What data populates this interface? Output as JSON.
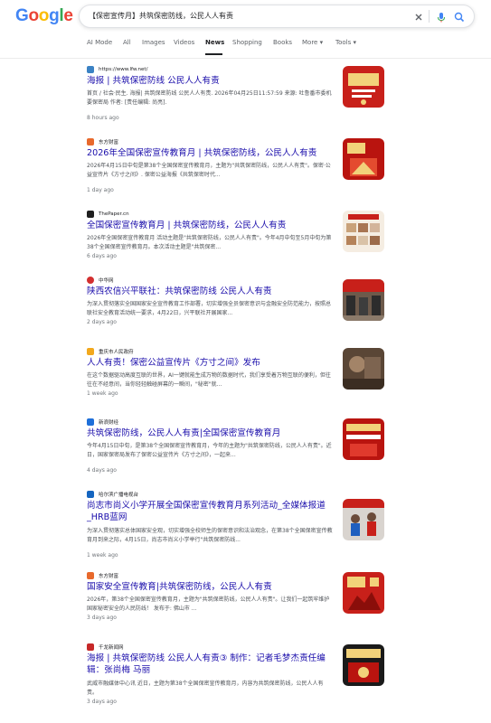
{
  "search": {
    "query": "【保密宣传月】共筑保密防线，公民人人有责",
    "logo": "Google"
  },
  "tabs": [
    {
      "label": "AI Mode"
    },
    {
      "label": "All"
    },
    {
      "label": "Images"
    },
    {
      "label": "Videos"
    },
    {
      "label": "News"
    },
    {
      "label": "Shopping"
    },
    {
      "label": "Books"
    },
    {
      "label": "More ▾"
    },
    {
      "label": "Tools ▾"
    }
  ],
  "results": [
    {
      "source": "https://www.lfw.net/",
      "title": "海报 | 共筑保密防线 公民人人有责",
      "snippet": "首页 / 社会·民生. 海报| 共筑保密防线 公民人人有责. 2026年04月25日11:57:59 来源: 吐鲁番市委机要保密局 作者: [责任编辑: 尚亮].",
      "age": "8 hours ago"
    },
    {
      "source": "东方财富",
      "title": "2026年全国保密宣传教育月 | 共筑保密防线，公民人人有责",
      "snippet": "2026年4月15日中旬是第38个全国保密宣传教育月，主题为\"共筑保密防线，公民人人有责\"。保密·公益宣传片《方寸之间》. 保密公益海报《共筑保密时代...",
      "age": "1 day ago"
    },
    {
      "source": "ThePaper.cn",
      "title": "全国保密宣传教育月 | 共筑保密防线，公民人人有责",
      "snippet": "2026年全国保密宣传教育月 活动主题是\"共筑保密防线，公民人人有责\"。今年4月中旬至5月中旬为第38个全国保密宣传教育月。本次活动主题是\"共筑保密...",
      "age": "6 days ago"
    },
    {
      "source": "中华网",
      "title": "陕西农信兴平联社：共筑保密防线 公民人人有责",
      "snippet": "为深入贯彻落实全国国家安全宣传教育工作部署，切实增强全员保密意识与金融安全防范能力，按照总联社安全教育活动统一要求，4月22日，兴平联社开展国家...",
      "age": "2 days ago"
    },
    {
      "source": "重庆市人民政府",
      "title": "人人有责！保密公益宣传片《方寸之间》发布",
      "snippet": "在这个数据驱动高度互联的世界，AI一键就能生成万物的数据时代，我们享受着万物互联的便利，但往往在不经意间，当你轻轻触碰屏幕的一瞬间，\"秘密\"就...",
      "age": "1 week ago"
    },
    {
      "source": "新浪财经",
      "title": "共筑保密防线，公民人人有责|全国保密宣传教育月",
      "snippet": "今年4月15日中旬，是第38个全国保密宣传教育月，今年的主题为\"共筑保密防线，公民人人有责\"。近日，国家保密局发布了保密公益宣传片《方寸之间》，一起来...",
      "age": "4 days ago"
    },
    {
      "source": "哈尔滨广播电视台",
      "title": "尚志市尚义小学开展全国保密宣传教育月系列活动_全媒体报道_HRB蓝网",
      "snippet": "为深入贯彻落实总体国家安全观，切实增强全校师生的保密意识和法治观念，在第38个全国保密宣传教育月到来之际，4月15日，尚志市尚义小学举行\"共筑保密防线...",
      "age": "1 week ago"
    },
    {
      "source": "东方财富",
      "title": "国家安全宣传教育|共筑保密防线，公民人人有责",
      "snippet": "2026年，第38个全国保密宣传教育月，主题为\"共筑保密防线，公民人人有责\"。让我们一起筑牢维护国家秘密安全的人民防线！ 发布于: 佛山市 ...",
      "age": "3 days ago"
    },
    {
      "source": "千龙新闻网",
      "title": "海报 | 共筑保密防线 公民人人有责③ 制作：记者毛梦杰责任编辑：张尚梅 马丽",
      "snippet": "武威市融媒体中心讯 近日，主题为第38个全国保密宣传教育月，内容为共筑保密防线，公民人人有责。",
      "age": "3 days ago"
    }
  ],
  "colors": {
    "link": "#1a0dab",
    "thumb_red": "#c8201a",
    "thumb_gold": "#f2d27a"
  }
}
